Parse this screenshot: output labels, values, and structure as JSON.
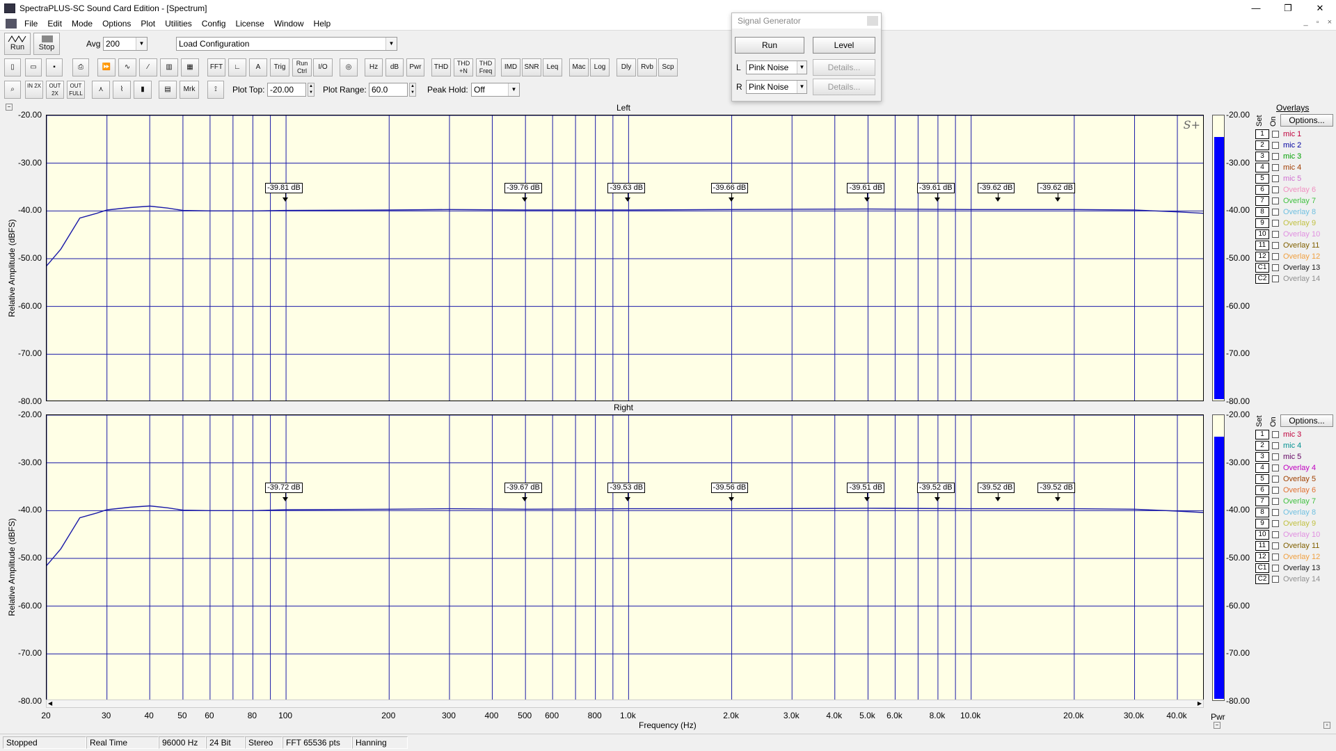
{
  "window": {
    "title": "SpectraPLUS-SC Sound Card Edition - [Spectrum]",
    "min": "—",
    "max": "❐",
    "close": "✕"
  },
  "menu": [
    "File",
    "Edit",
    "Mode",
    "Options",
    "Plot",
    "Utilities",
    "Config",
    "License",
    "Window",
    "Help"
  ],
  "toolbar1": {
    "run": "Run",
    "stop": "Stop",
    "avg_label": "Avg",
    "avg_value": "200",
    "config": "Load Configuration"
  },
  "toolbar2": {
    "buttons": [
      "FFT",
      "",
      "",
      "Trig",
      "Run Ctrl",
      "I/O",
      "",
      "Hz",
      "dB",
      "Pwr",
      "THD",
      "THD +N",
      "THD Freq",
      "IMD",
      "SNR",
      "Leq",
      "Mac",
      "Log",
      "Dly",
      "Rvb",
      "Scp"
    ]
  },
  "toolbar3": {
    "plot_top_label": "Plot Top:",
    "plot_top": "-20.00",
    "plot_range_label": "Plot Range:",
    "plot_range": "60.0",
    "peak_hold_label": "Peak Hold:",
    "peak_hold": "Off",
    "marker_btn": "Mrk",
    "zoom_btns": [
      "",
      "IN 2X",
      "OUT 2X",
      "OUT FULL"
    ]
  },
  "signal_generator": {
    "title": "Signal Generator",
    "run": "Run",
    "level": "Level",
    "left_label": "L",
    "left_value": "Pink Noise",
    "left_details": "Details...",
    "right_label": "R",
    "right_value": "Pink Noise",
    "right_details": "Details..."
  },
  "plots": {
    "ylabel": "Relative Amplitude (dBFS)",
    "xlabel": "Frequency (Hz)",
    "pwr_label": "Pwr",
    "left_title": "Left",
    "right_title": "Right",
    "logo": "S+",
    "y_ticks": [
      "-20.00",
      "-30.00",
      "-40.00",
      "-50.00",
      "-60.00",
      "-70.00",
      "-80.00"
    ],
    "x_ticks": [
      "20",
      "30",
      "40",
      "50",
      "60",
      "80",
      "100",
      "200",
      "300",
      "400",
      "500",
      "600",
      "800",
      "1.0k",
      "2.0k",
      "3.0k",
      "4.0k",
      "5.0k",
      "6.0k",
      "8.0k",
      "10.0k",
      "20.0k",
      "30.0k",
      "40.0k"
    ]
  },
  "chart_data": [
    {
      "type": "line",
      "title": "Left",
      "xlabel": "Frequency (Hz)",
      "ylabel": "Relative Amplitude (dBFS)",
      "x_scale": "log",
      "xlim": [
        20,
        48000
      ],
      "ylim": [
        -80,
        -20
      ],
      "grid": true,
      "x": [
        20,
        22,
        25,
        28,
        30,
        35,
        40,
        45,
        50,
        60,
        80,
        100,
        200,
        300,
        500,
        1000,
        2000,
        5000,
        10000,
        20000,
        30000,
        40000,
        48000
      ],
      "values": [
        -51.5,
        -48,
        -41.5,
        -40.5,
        -39.8,
        -39.3,
        -39.0,
        -39.4,
        -39.9,
        -40.0,
        -40.0,
        -39.9,
        -39.8,
        -39.7,
        -39.8,
        -39.8,
        -39.7,
        -39.6,
        -39.7,
        -39.7,
        -39.8,
        -40.2,
        -40.5
      ],
      "markers": [
        {
          "x": 100,
          "label": "-39.81 dB"
        },
        {
          "x": 500,
          "label": "-39.76 dB"
        },
        {
          "x": 1000,
          "label": "-39.63 dB"
        },
        {
          "x": 2000,
          "label": "-39.66 dB"
        },
        {
          "x": 5000,
          "label": "-39.61 dB"
        },
        {
          "x": 8000,
          "label": "-39.61 dB"
        },
        {
          "x": 12000,
          "label": "-39.62 dB"
        },
        {
          "x": 18000,
          "label": "-39.62 dB"
        }
      ],
      "power_level": -24.5
    },
    {
      "type": "line",
      "title": "Right",
      "xlabel": "Frequency (Hz)",
      "ylabel": "Relative Amplitude (dBFS)",
      "x_scale": "log",
      "xlim": [
        20,
        48000
      ],
      "ylim": [
        -80,
        -20
      ],
      "grid": true,
      "x": [
        20,
        22,
        25,
        28,
        30,
        35,
        40,
        45,
        50,
        60,
        80,
        100,
        200,
        300,
        500,
        1000,
        2000,
        5000,
        10000,
        20000,
        30000,
        40000,
        48000
      ],
      "values": [
        -51.5,
        -48,
        -41.5,
        -40.5,
        -39.8,
        -39.3,
        -39.0,
        -39.4,
        -39.9,
        -40.0,
        -40.0,
        -39.8,
        -39.7,
        -39.6,
        -39.7,
        -39.6,
        -39.6,
        -39.5,
        -39.6,
        -39.6,
        -39.7,
        -40.1,
        -40.4
      ],
      "markers": [
        {
          "x": 100,
          "label": "-39.72 dB"
        },
        {
          "x": 500,
          "label": "-39.67 dB"
        },
        {
          "x": 1000,
          "label": "-39.53 dB"
        },
        {
          "x": 2000,
          "label": "-39.56 dB"
        },
        {
          "x": 5000,
          "label": "-39.51 dB"
        },
        {
          "x": 8000,
          "label": "-39.52 dB"
        },
        {
          "x": 12000,
          "label": "-39.52 dB"
        },
        {
          "x": 18000,
          "label": "-39.52 dB"
        }
      ],
      "power_level": -24.5
    }
  ],
  "overlays": {
    "title": "Overlays",
    "options": "Options...",
    "set_label": "Set",
    "on_label": "On",
    "left": [
      {
        "n": "1",
        "name": "mic 1",
        "color": "#c0003c"
      },
      {
        "n": "2",
        "name": "mic 2",
        "color": "#0000a0"
      },
      {
        "n": "3",
        "name": "mic 3",
        "color": "#00a000"
      },
      {
        "n": "4",
        "name": "mic 4",
        "color": "#a03c00"
      },
      {
        "n": "5",
        "name": "mic 5",
        "color": "#d070d0"
      },
      {
        "n": "6",
        "name": "Overlay 6",
        "color": "#f090c0"
      },
      {
        "n": "7",
        "name": "Overlay 7",
        "color": "#40c040"
      },
      {
        "n": "8",
        "name": "Overlay 8",
        "color": "#70c0e0"
      },
      {
        "n": "9",
        "name": "Overlay 9",
        "color": "#c0c040"
      },
      {
        "n": "10",
        "name": "Overlay 10",
        "color": "#e090e0"
      },
      {
        "n": "11",
        "name": "Overlay 11",
        "color": "#806000"
      },
      {
        "n": "12",
        "name": "Overlay 12",
        "color": "#f0a040"
      },
      {
        "n": "C1",
        "name": "Overlay 13",
        "color": "#202020"
      },
      {
        "n": "C2",
        "name": "Overlay 14",
        "color": "#909090"
      }
    ],
    "right": [
      {
        "n": "1",
        "name": "mic 3",
        "color": "#c0003c"
      },
      {
        "n": "2",
        "name": "mic 4",
        "color": "#009090"
      },
      {
        "n": "3",
        "name": "mic 5",
        "color": "#600060"
      },
      {
        "n": "4",
        "name": "Overlay 4",
        "color": "#c000c0"
      },
      {
        "n": "5",
        "name": "Overlay 5",
        "color": "#a04000"
      },
      {
        "n": "6",
        "name": "Overlay 6",
        "color": "#e07030"
      },
      {
        "n": "7",
        "name": "Overlay 7",
        "color": "#40c040"
      },
      {
        "n": "8",
        "name": "Overlay 8",
        "color": "#70c0e0"
      },
      {
        "n": "9",
        "name": "Overlay 9",
        "color": "#c0c040"
      },
      {
        "n": "10",
        "name": "Overlay 10",
        "color": "#e090e0"
      },
      {
        "n": "11",
        "name": "Overlay 11",
        "color": "#806000"
      },
      {
        "n": "12",
        "name": "Overlay 12",
        "color": "#f0a040"
      },
      {
        "n": "C1",
        "name": "Overlay 13",
        "color": "#202020"
      },
      {
        "n": "C2",
        "name": "Overlay 14",
        "color": "#909090"
      }
    ]
  },
  "status": [
    "Stopped",
    "Real Time",
    "96000 Hz",
    "24 Bit",
    "Stereo",
    "FFT 65536 pts",
    "Hanning"
  ],
  "colors": {
    "grid": "#1a1aa8",
    "trace": "#1a1aa8",
    "plot_bg": "#ffffe6",
    "power": "#0000ff"
  }
}
